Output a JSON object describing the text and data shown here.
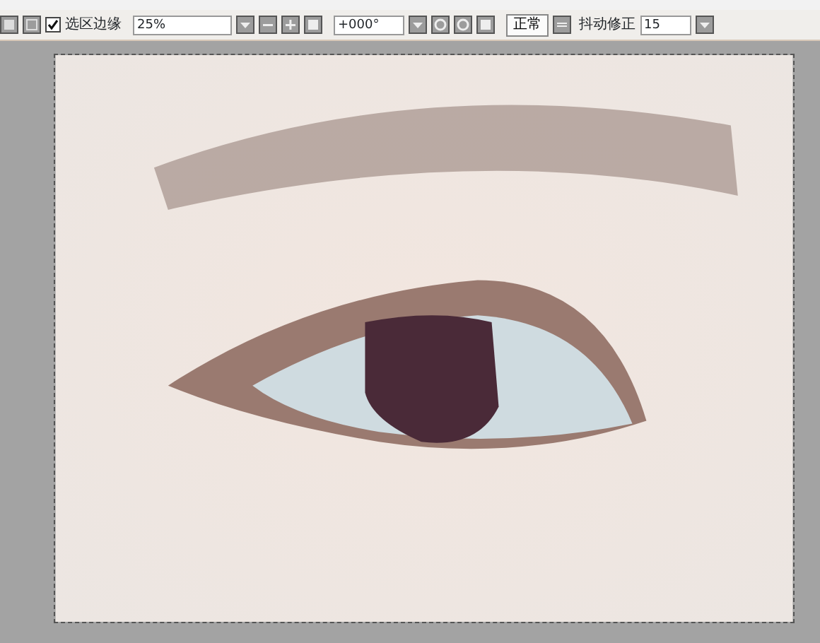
{
  "toolbar": {
    "selection_edge": {
      "label": "选区边缘",
      "checked": true
    },
    "zoom": "25%",
    "angle": "+000°",
    "blend_mode": "正常",
    "stabilizer": {
      "label": "抖动修正",
      "value": "15"
    }
  }
}
